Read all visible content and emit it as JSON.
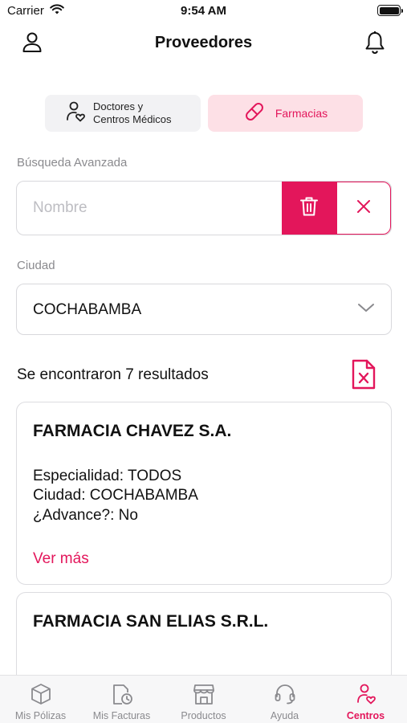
{
  "status_bar": {
    "carrier": "Carrier",
    "time": "9:54 AM",
    "icons": [
      "wifi-icon",
      "battery-icon"
    ]
  },
  "nav": {
    "title": "Proveedores",
    "left_icon": "user-icon",
    "right_icon": "bell-icon"
  },
  "segments": [
    {
      "label_line1": "Doctores y",
      "label_line2": "Centros Médicos",
      "icon": "doctor-heart-icon",
      "selected": false
    },
    {
      "label": "Farmacias",
      "icon": "pill-icon",
      "selected": true
    }
  ],
  "search": {
    "section_label": "Búsqueda Avanzada",
    "placeholder": "Nombre",
    "value": "",
    "delete_icon": "trash-icon",
    "clear_icon": "close-icon"
  },
  "city": {
    "label": "Ciudad",
    "selected": "COCHABAMBA",
    "icon": "chevron-down-icon"
  },
  "results": {
    "summary": "Se encontraron 7 resultados",
    "export_icon": "file-x-icon"
  },
  "cards": [
    {
      "name": "FARMACIA CHAVEZ S.A.",
      "specialty": "Especialidad: TODOS",
      "city": "Ciudad: COCHABAMBA",
      "advance": "¿Advance?: No",
      "link": "Ver más"
    },
    {
      "name": "FARMACIA SAN ELIAS S.R.L."
    }
  ],
  "tab_bar": [
    {
      "label": "Mis Pólizas",
      "icon": "cube-icon",
      "active": false
    },
    {
      "label": "Mis Facturas",
      "icon": "invoice-clock-icon",
      "active": false
    },
    {
      "label": "Productos",
      "icon": "store-icon",
      "active": false
    },
    {
      "label": "Ayuda",
      "icon": "headset-icon",
      "active": false
    },
    {
      "label": "Centros",
      "icon": "doctor-heart-icon",
      "active": true
    }
  ],
  "colors": {
    "accent": "#e3165b",
    "accent_light": "#fde0e6",
    "muted": "#8a8a8e",
    "border": "#d8d8dc"
  }
}
